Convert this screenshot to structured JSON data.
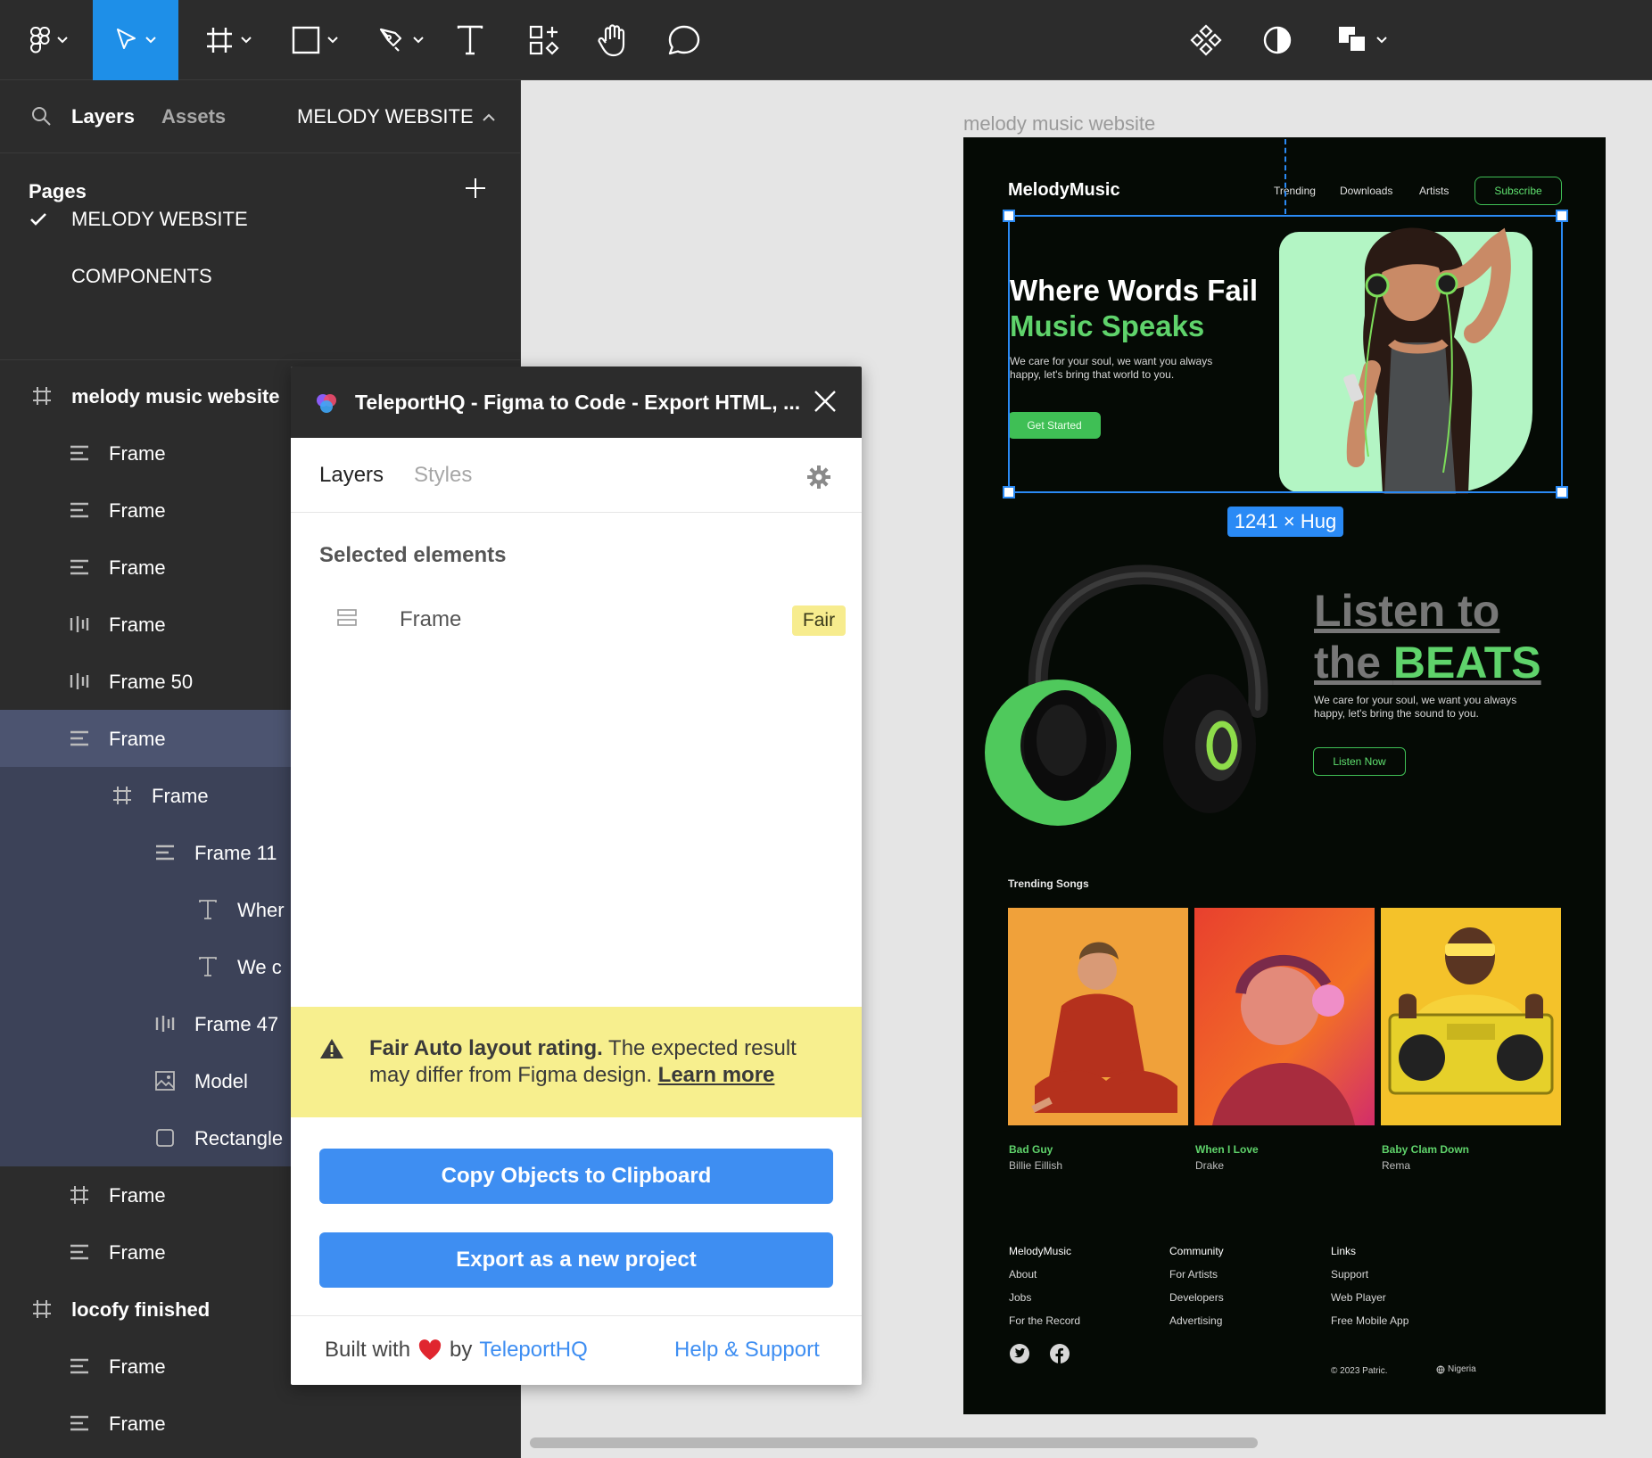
{
  "toolbar": {
    "tools": [
      "figma-menu",
      "move",
      "frame",
      "shape",
      "pen",
      "text",
      "resources",
      "hand",
      "comment"
    ],
    "right_tools": [
      "component",
      "theme",
      "multiplayer"
    ]
  },
  "left_panel": {
    "tab_layers": "Layers",
    "tab_assets": "Assets",
    "current_page": "MELODY WEBSITE",
    "pages_title": "Pages",
    "pages": [
      "MELODY WEBSITE",
      "COMPONENTS"
    ],
    "layers": [
      {
        "name": "melody music website",
        "icon": "frame-hash"
      },
      {
        "name": "Frame",
        "icon": "autolayout-vertical"
      },
      {
        "name": "Frame",
        "icon": "autolayout-vertical"
      },
      {
        "name": "Frame",
        "icon": "autolayout-vertical"
      },
      {
        "name": "Frame",
        "icon": "autolayout-horizontal"
      },
      {
        "name": "Frame 50",
        "icon": "autolayout-horizontal"
      },
      {
        "name": "Frame",
        "icon": "autolayout-vertical"
      },
      {
        "name": "Frame",
        "icon": "frame-hash"
      },
      {
        "name": "Frame 11",
        "icon": "autolayout-vertical"
      },
      {
        "name": "Wher",
        "icon": "text"
      },
      {
        "name": "We c",
        "icon": "text"
      },
      {
        "name": "Frame 47",
        "icon": "autolayout-horizontal"
      },
      {
        "name": "Model",
        "icon": "image"
      },
      {
        "name": "Rectangle",
        "icon": "rectangle"
      },
      {
        "name": "Frame",
        "icon": "frame-hash"
      },
      {
        "name": "Frame",
        "icon": "autolayout-vertical"
      },
      {
        "name": "locofy finished",
        "icon": "frame-hash"
      },
      {
        "name": "Frame",
        "icon": "autolayout-vertical"
      },
      {
        "name": "Frame",
        "icon": "autolayout-vertical"
      }
    ]
  },
  "canvas": {
    "frame_label": "melody music website",
    "size_badge": "1241 × Hug"
  },
  "site": {
    "logo": "MelodyMusic",
    "nav": [
      "Trending",
      "Downloads",
      "Artists"
    ],
    "subscribe": "Subscribe",
    "hero_line1": "Where Words Fail",
    "hero_line2": "Music Speaks",
    "hero_sub": "We care for your soul, we want you always happy, let's bring that world to you.",
    "hero_button": "Get Started",
    "beats_line1": "Listen to",
    "beats_line2a": "the ",
    "beats_line2b": "BEATS",
    "beats_sub": "We care for your soul, we want you always happy, let's bring the sound to you.",
    "beats_button": "Listen Now",
    "trending_title": "Trending Songs",
    "songs": [
      {
        "title": "Bad Guy",
        "artist": "Billie Eillish"
      },
      {
        "title": "When I Love",
        "artist": "Drake"
      },
      {
        "title": "Baby Clam Down",
        "artist": "Rema"
      }
    ],
    "footer": [
      {
        "head": "MelodyMusic",
        "links": [
          "About",
          "Jobs",
          "For the Record"
        ]
      },
      {
        "head": "Community",
        "links": [
          "For Artists",
          "Developers",
          "Advertising"
        ]
      },
      {
        "head": "Links",
        "links": [
          "Support",
          "Web Player",
          "Free Mobile App"
        ]
      }
    ],
    "copyright": "© 2023 Patric.",
    "country": "Nigeria"
  },
  "plugin": {
    "title": "TeleportHQ - Figma to Code - Export HTML, ...",
    "tab_layers": "Layers",
    "tab_styles": "Styles",
    "selected_heading": "Selected elements",
    "selected_item": "Frame",
    "rating_badge": "Fair",
    "warning_bold": "Fair Auto layout rating.",
    "warning_text": " The expected result may differ from Figma design. ",
    "warning_link": "Learn more",
    "copy_button": "Copy Objects to Clipboard",
    "export_button": "Export as a new project",
    "built_with": "Built with",
    "by": "by",
    "brand": "TeleportHQ",
    "help": "Help & Support"
  },
  "colors": {
    "accent_blue": "#1e8fe8",
    "site_green": "#5fd36b",
    "warning_yellow": "#f7ef8e",
    "button_blue": "#3e8ef2"
  }
}
